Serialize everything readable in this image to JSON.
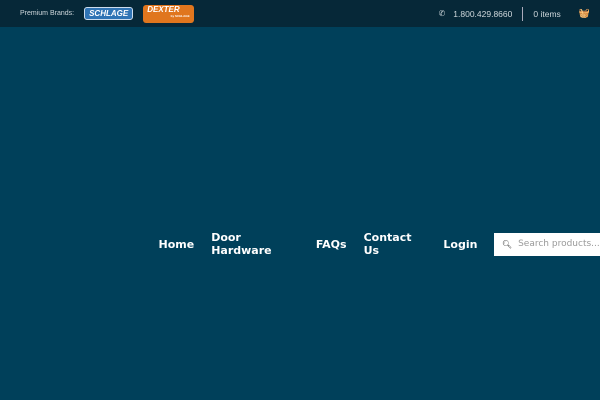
{
  "topbar": {
    "premium_label": "Premium Brands:",
    "brands": [
      "SCHLAGE",
      "DEXTER"
    ],
    "dexter_sub": "by SCHLAGE",
    "phone": "1.800.429.8660",
    "cart_count": "0 items"
  },
  "nav": {
    "items": [
      "Home",
      "Door Hardware",
      "FAQs",
      "Contact Us",
      "Login"
    ],
    "search_placeholder": "Search products..."
  }
}
